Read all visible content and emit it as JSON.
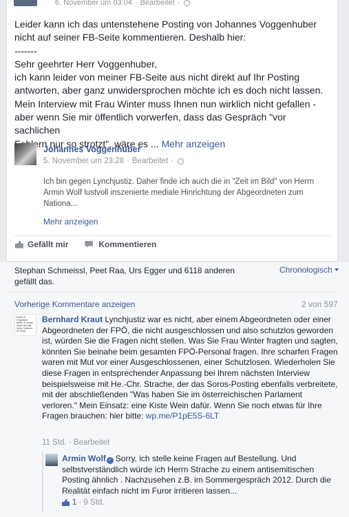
{
  "post": {
    "timestamp": "6. November um 03:04",
    "edited": "Bearbeitet",
    "text_lines": [
      "Leider kann ich das untenstehene Posting von Johannes Voggenhuber",
      "nicht auf seiner FB-Seite kommentieren. Deshalb hier:",
      "-------",
      "Sehr geehrter Herr Voggenhuber,",
      "ich kann leider von meiner FB-Seite aus nicht direkt auf Ihr Posting",
      "antworten, aber ganz unwidersprochen möchte ich es doch nicht lassen.",
      "Mein Interview mit Frau Winter muss Ihnen nun wirklich nicht gefallen -",
      "aber wenn Sie mir öffentlich vorwerfen, dass das Gespräch \"vor sachlichen",
      "Fehlern nur so strotzt\", wäre es ..."
    ],
    "see_more": "Mehr anzeigen"
  },
  "shared": {
    "author": "Johannes Voggenhuber",
    "timestamp": "5. November um 23:28",
    "edited": "Bearbeitet",
    "text": "Ich bin gegen Lynchjustiz. Daher finde ich auch die in \"Zeit im Bild\" von Herrn Armin Wolf lustvoll inszenierte mediale Hinrichtung der Abgeordneten zum Nationa...",
    "see_more": "Mehr anzeigen"
  },
  "actions": {
    "like": "Gefällt mir",
    "comment": "Kommentieren"
  },
  "likes": {
    "text": "Stephan Schmeissl, Peet Raa, Urs Egger und 6118 anderen gefällt das.",
    "order": "Chronologisch"
  },
  "comments_nav": {
    "previous": "Vorherige Kommentare anzeigen",
    "count": "2 von 597"
  },
  "comment1": {
    "avatar_text": "Partei of Organised Belief. To better share Secular Value Systems of Views",
    "author": "Bernhard Kraut",
    "text": "Lynchjustiz war es nicht, aber einem Abgeordneten oder einer Abgeordneten der FPÖ, die nicht ausgeschlossen und also schutzlos geworden ist, würden Sie die Fragen nicht stellen. Was Sie Frau Winter fragten und sagten, könnten Sie beinahe beim gesamten FPÖ-Personal fragen. Ihre scharfen Fragen waren mit Mut vor einer Ausgeschlossenen, einer Schutzlosen. Wiederholen Sie diese Fragen in entsprechender Anpassung bei Ihrem nächsten Interview beispielsweise mit He.-Chr. Strache, der das Soros-Posting ebenfalls verbreitete, mit der abschließenden \"Was haben Sie im österreichischen Parlament verloren.\" Mein Einsatz: eine Kiste Wein dafür. Wenn Sie noch etwas für Ihre Fragen brauchen: hier bitte:",
    "link": "wp.me/P1pE5S-6LT",
    "meta": "11 Std. · Bearbeitet"
  },
  "comment2": {
    "author": "Armin Wolf",
    "text": "Sorry, ich stelle keine Fragen auf Bestellung. Und selbstverständlich würde ich Herrn Strache zu einem antisemitischen Posting ähnlich . Nachzusehen z.B. im Sommergespräch 2012. Durch die Realität einfach nicht im Furor irritieren lassen...",
    "likes": "1",
    "time": "· 9 Std."
  }
}
